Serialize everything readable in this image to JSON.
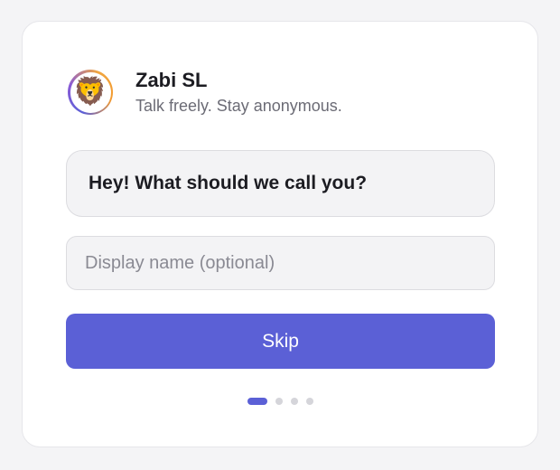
{
  "app": {
    "title": "Zabi SL",
    "subtitle": "Talk freely. Stay anonymous.",
    "avatar_emoji": "🦁",
    "avatar_icon": "lion-icon"
  },
  "onboarding": {
    "prompt": "Hey! What should we call you?",
    "name_input": {
      "value": "",
      "placeholder": "Display name (optional)"
    },
    "skip_label": "Skip",
    "pagination": {
      "total_steps": 4,
      "current_step": 1
    }
  },
  "colors": {
    "accent": "#5b60d6",
    "card_background": "#ffffff",
    "bubble_background": "#f3f3f5",
    "inactive_dot": "#d5d5da"
  }
}
